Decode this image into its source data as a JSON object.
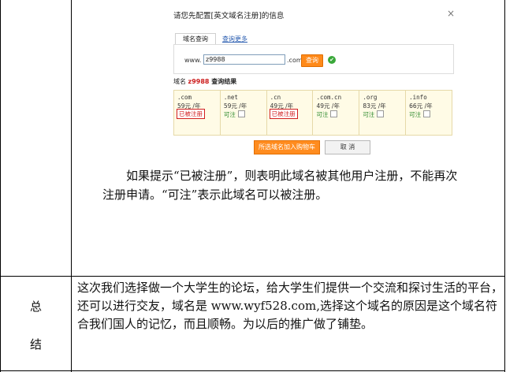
{
  "dialog": {
    "title": "请您先配置[英文域名注册]的信息",
    "close": "×",
    "tabs": {
      "active": "域名查询",
      "more": "查询更多"
    },
    "search": {
      "prefix": "www.",
      "value": "z9988",
      "suffix": ".com",
      "button": "查询"
    },
    "result_head": {
      "pre": "域名 ",
      "domain": "z9988",
      "post": " 查询结果"
    },
    "results": [
      {
        "ext": ".com",
        "price": "59元 /年",
        "status": "已被注册",
        "available": false
      },
      {
        "ext": ".net",
        "price": "59元 /年",
        "status": "可注",
        "available": true
      },
      {
        "ext": ".cn",
        "price": "49元 /年",
        "status": "已被注册",
        "available": false
      },
      {
        "ext": ".com.cn",
        "price": "49元 /年",
        "status": "可注",
        "available": true
      },
      {
        "ext": ".org",
        "price": "83元 /年",
        "status": "可注",
        "available": true
      },
      {
        "ext": ".info",
        "price": "66元 /年",
        "status": "可注",
        "available": true
      }
    ],
    "buttons": {
      "add_cart": "所选域名加入购物车",
      "cancel": "取 消"
    }
  },
  "body_text": {
    "line1": "如果提示“已被注册”，则表明此域名被其他用户注册，不能再次",
    "line2": "注册申请。“可注”表示此域名可以被注册。"
  },
  "summary": {
    "label_char1": "总",
    "label_char2": "结",
    "text": "这次我们选择做一个大学生的论坛，给大学生们提供一个交流和探讨生活的平台，还可以进行交友，域名是 www.wyf528.com,选择这个域名的原因是这个域名符合我们国人的记忆，而且顺畅。为以后的推广做了铺垫。"
  },
  "colors": {
    "accent_orange": "#ff8a1a",
    "taken_red": "#d21e1e",
    "available_green": "#2e8b2e",
    "result_bg": "#fffbe6"
  }
}
